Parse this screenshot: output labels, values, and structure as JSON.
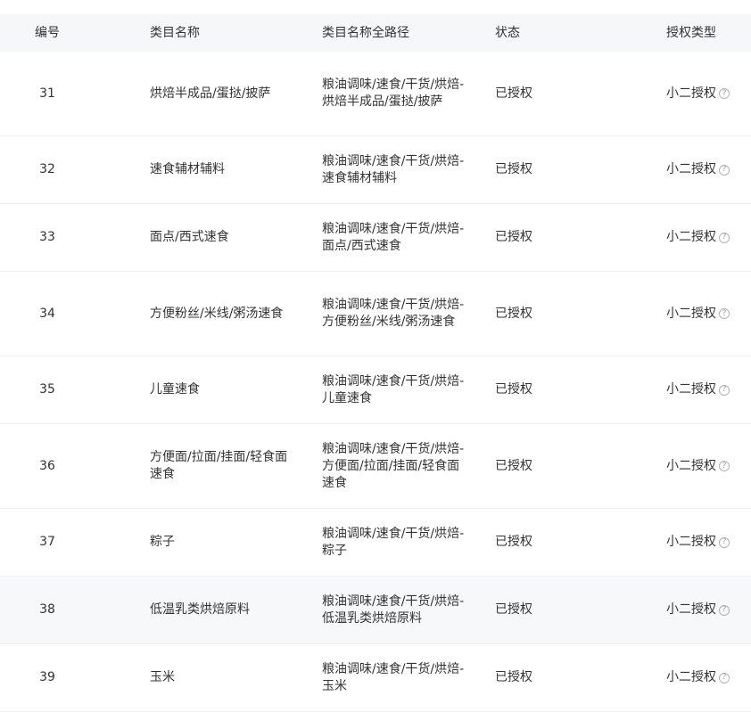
{
  "columns": {
    "id": "编号",
    "name": "类目名称",
    "path": "类目名称全路径",
    "status": "状态",
    "auth": "授权类型"
  },
  "rows": [
    {
      "id": "31",
      "name": "烘焙半成品/蛋挞/披萨",
      "path": "粮油调味/速食/干货/烘焙-烘焙半成品/蛋挞/披萨",
      "status": "已授权",
      "auth": "小二授权"
    },
    {
      "id": "32",
      "name": "速食辅材辅料",
      "path": "粮油调味/速食/干货/烘焙-速食辅材辅料",
      "status": "已授权",
      "auth": "小二授权"
    },
    {
      "id": "33",
      "name": "面点/西式速食",
      "path": "粮油调味/速食/干货/烘焙-面点/西式速食",
      "status": "已授权",
      "auth": "小二授权"
    },
    {
      "id": "34",
      "name": "方便粉丝/米线/粥汤速食",
      "path": "粮油调味/速食/干货/烘焙-方便粉丝/米线/粥汤速食",
      "status": "已授权",
      "auth": "小二授权"
    },
    {
      "id": "35",
      "name": "儿童速食",
      "path": "粮油调味/速食/干货/烘焙-儿童速食",
      "status": "已授权",
      "auth": "小二授权"
    },
    {
      "id": "36",
      "name": "方便面/拉面/挂面/轻食面速食",
      "path": "粮油调味/速食/干货/烘焙-方便面/拉面/挂面/轻食面速食",
      "status": "已授权",
      "auth": "小二授权"
    },
    {
      "id": "37",
      "name": "粽子",
      "path": "粮油调味/速食/干货/烘焙-粽子",
      "status": "已授权",
      "auth": "小二授权"
    },
    {
      "id": "38",
      "name": "低温乳类烘焙原料",
      "path": "粮油调味/速食/干货/烘焙-低温乳类烘焙原料",
      "status": "已授权",
      "auth": "小二授权",
      "highlighted": true
    },
    {
      "id": "39",
      "name": "玉米",
      "path": "粮油调味/速食/干货/烘焙-玉米",
      "status": "已授权",
      "auth": "小二授权"
    }
  ],
  "icons": {
    "help": "question-circle-icon"
  }
}
